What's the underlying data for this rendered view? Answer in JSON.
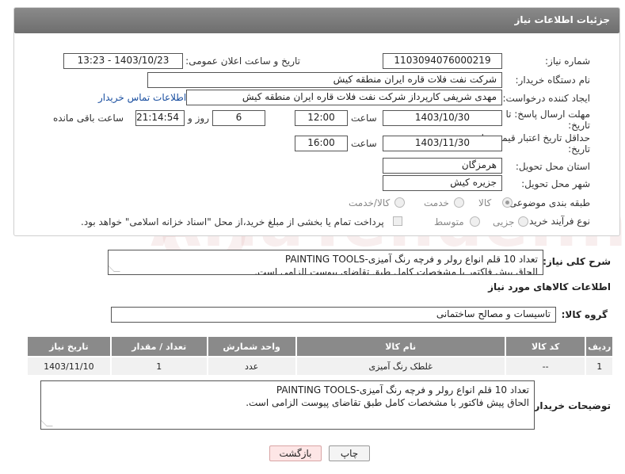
{
  "header": {
    "title": "جزئیات اطلاعات نیاز"
  },
  "need_number": {
    "label": "شماره نیاز:",
    "value": "1103094076000219"
  },
  "announce_datetime": {
    "label": "تاریخ و ساعت اعلان عمومی:",
    "value": "1403/10/23 - 13:23"
  },
  "buyer_org": {
    "label": "نام دستگاه خریدار:",
    "value": "شرکت نفت فلات قاره ایران منطقه کیش"
  },
  "requester": {
    "label": "ایجاد کننده درخواست:",
    "value": "مهدی شریفی کارپرداز شرکت نفت فلات قاره ایران منطقه کیش",
    "contact_link": "اطلاعات تماس خریدار"
  },
  "reply_deadline": {
    "label_line1": "مهلت ارسال پاسخ: تا",
    "label_line2": "تاریخ:",
    "date": "1403/10/30",
    "time_label": "ساعت",
    "time": "12:00",
    "days": "6",
    "days_label": "روز و",
    "remaining": "21:14:54",
    "remaining_label": "ساعت باقی مانده"
  },
  "price_validity": {
    "label_line1": "حداقل تاریخ اعتبار قیمت: تا",
    "label_line2": "تاریخ:",
    "date": "1403/11/30",
    "time_label": "ساعت",
    "time": "16:00"
  },
  "delivery_province": {
    "label": "استان محل تحویل:",
    "value": "هرمزگان"
  },
  "delivery_city": {
    "label": "شهر محل تحویل:",
    "value": "جزیره کیش"
  },
  "category": {
    "label": "طبقه بندی موضوعی:",
    "options": [
      "کالا",
      "خدمت",
      "کالا/خدمت"
    ],
    "selected": "کالا"
  },
  "purchase_type": {
    "label": "نوع فرآیند خرید :",
    "options": [
      "جزیی",
      "متوسط"
    ],
    "note": "پرداخت تمام یا بخشی از مبلغ خرید،از محل \"اسناد خزانه اسلامی\" خواهد بود."
  },
  "general_description": {
    "label": "شرح کلی نیاز:",
    "line1": "تعداد 10 قلم انواع رولر و فرچه رنگ آمیزی-PAINTING TOOLS",
    "line2": "الحاق پیش فاکتور با مشخصات کامل طبق تقاضای پیوست الزامی است."
  },
  "items_section": {
    "title": "اطلاعات کالاهای مورد نیاز"
  },
  "goods_group": {
    "label": "گروه کالا:",
    "value": "تاسیسات و مصالح ساختمانی"
  },
  "items_table": {
    "headers": [
      "ردیف",
      "کد کالا",
      "نام کالا",
      "واحد شمارش",
      "تعداد / مقدار",
      "تاریخ نیاز"
    ],
    "rows": [
      [
        "1",
        "--",
        "غلطک رنگ آمیزی",
        "عدد",
        "1",
        "1403/11/10"
      ]
    ]
  },
  "buyer_notes": {
    "label": "توضیحات خریدار:",
    "line1": "تعداد 10 قلم انواع رولر و فرچه رنگ آمیزی-PAINTING TOOLS",
    "line2": "الحاق پیش فاکتور با مشخصات کامل طبق تقاضای پیوست الزامی است."
  },
  "buttons": {
    "print": "چاپ",
    "back": "بازگشت"
  },
  "watermark": {
    "text": "AriaTender.neT"
  }
}
